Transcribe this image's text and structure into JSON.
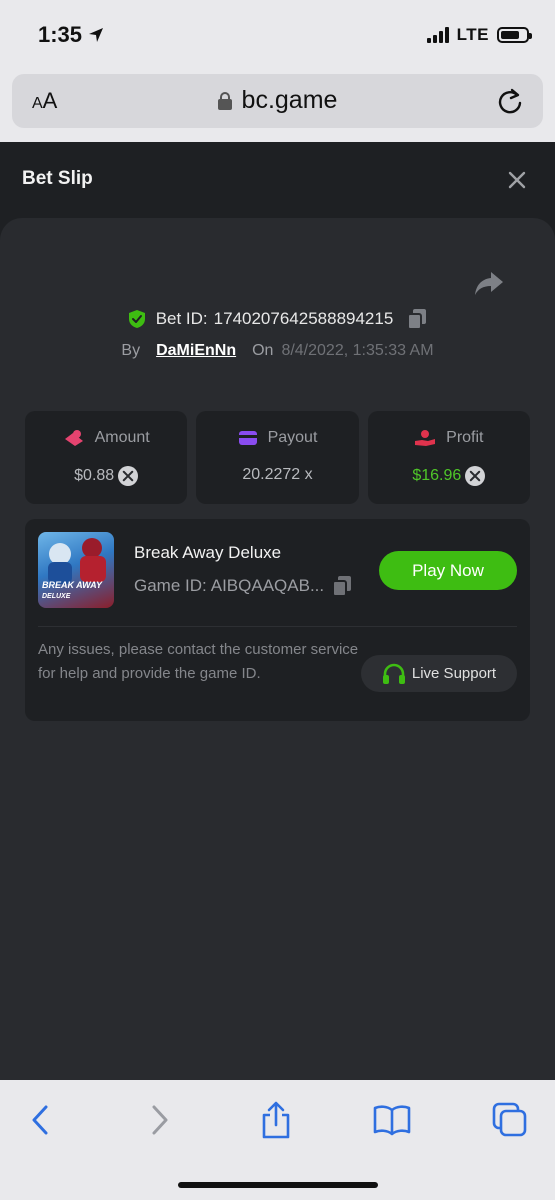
{
  "status_bar": {
    "time": "1:35",
    "network": "LTE"
  },
  "browser": {
    "text_size_label": "AA",
    "url": "bc.game"
  },
  "bet_slip": {
    "title": "Bet Slip",
    "bet_id_label": "Bet ID:",
    "bet_id": "1740207642588894215",
    "by_label": "By",
    "username": "DaMiEnNn",
    "on_label": "On",
    "datetime": "8/4/2022, 1:35:33 AM"
  },
  "stats": {
    "amount_label": "Amount",
    "amount_value": "$0.88",
    "payout_label": "Payout",
    "payout_value": "20.2272 x",
    "profit_label": "Profit",
    "profit_value": "$16.96"
  },
  "game": {
    "name": "Break Away Deluxe",
    "id_label": "Game ID:",
    "id_value": "AIBQAAQAB...",
    "thumb_title": "BREAK AWAY",
    "thumb_subtitle": "DELUXE",
    "play_label": "Play Now",
    "help_text": "Any issues, please contact the customer service for help and provide the game ID.",
    "support_label": "Live Support"
  },
  "colors": {
    "accent_green": "#3ebd12",
    "profit_green": "#4fc629",
    "panel_bg": "#292b2f",
    "ios_blue": "#2f6fe0"
  }
}
